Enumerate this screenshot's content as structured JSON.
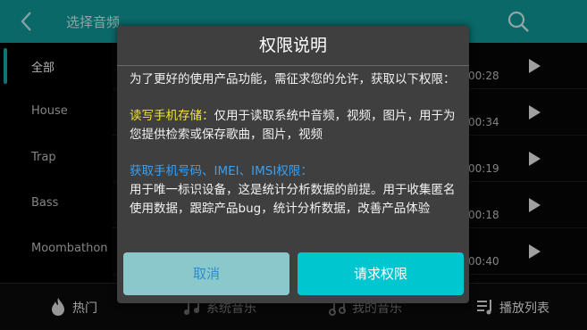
{
  "header": {
    "title": "选择音频"
  },
  "sidebar": {
    "items": [
      {
        "label": "全部"
      },
      {
        "label": "House"
      },
      {
        "label": "Trap"
      },
      {
        "label": "Bass"
      },
      {
        "label": "Moombathon"
      }
    ]
  },
  "list": {
    "rows": [
      {
        "duration": "00:28"
      },
      {
        "duration": "00:34"
      },
      {
        "duration": "00:19"
      },
      {
        "duration": "00:18"
      },
      {
        "duration": "00:40"
      }
    ]
  },
  "bottom_nav": {
    "tabs": [
      {
        "label": "热门"
      },
      {
        "label": "系统音乐"
      },
      {
        "label": "我的音乐"
      },
      {
        "label": "播放列表"
      }
    ]
  },
  "dialog": {
    "title": "权限说明",
    "intro": "为了更好的使用产品功能，需征求您的允许，获取以下权限：",
    "storage_title": "读写手机存储：",
    "storage_text": "仅用于读取系统中音频，视频，图片，用于为您提供检索或保存歌曲，图片，视频",
    "phone_title": "获取手机号码、IMEI、IMSI权限：",
    "phone_text": "用于唯一标识设备，这是统计分析数据的前提。用于收集匿名使用数据，跟踪产品bug，统计分析数据，改善产品体验",
    "cancel_label": "取消",
    "confirm_label": "请求权限"
  },
  "colors": {
    "accent": "#0f9596",
    "confirm": "#00c6cf",
    "highlight_yellow": "#f0e23a",
    "highlight_blue": "#3aa0f2"
  }
}
